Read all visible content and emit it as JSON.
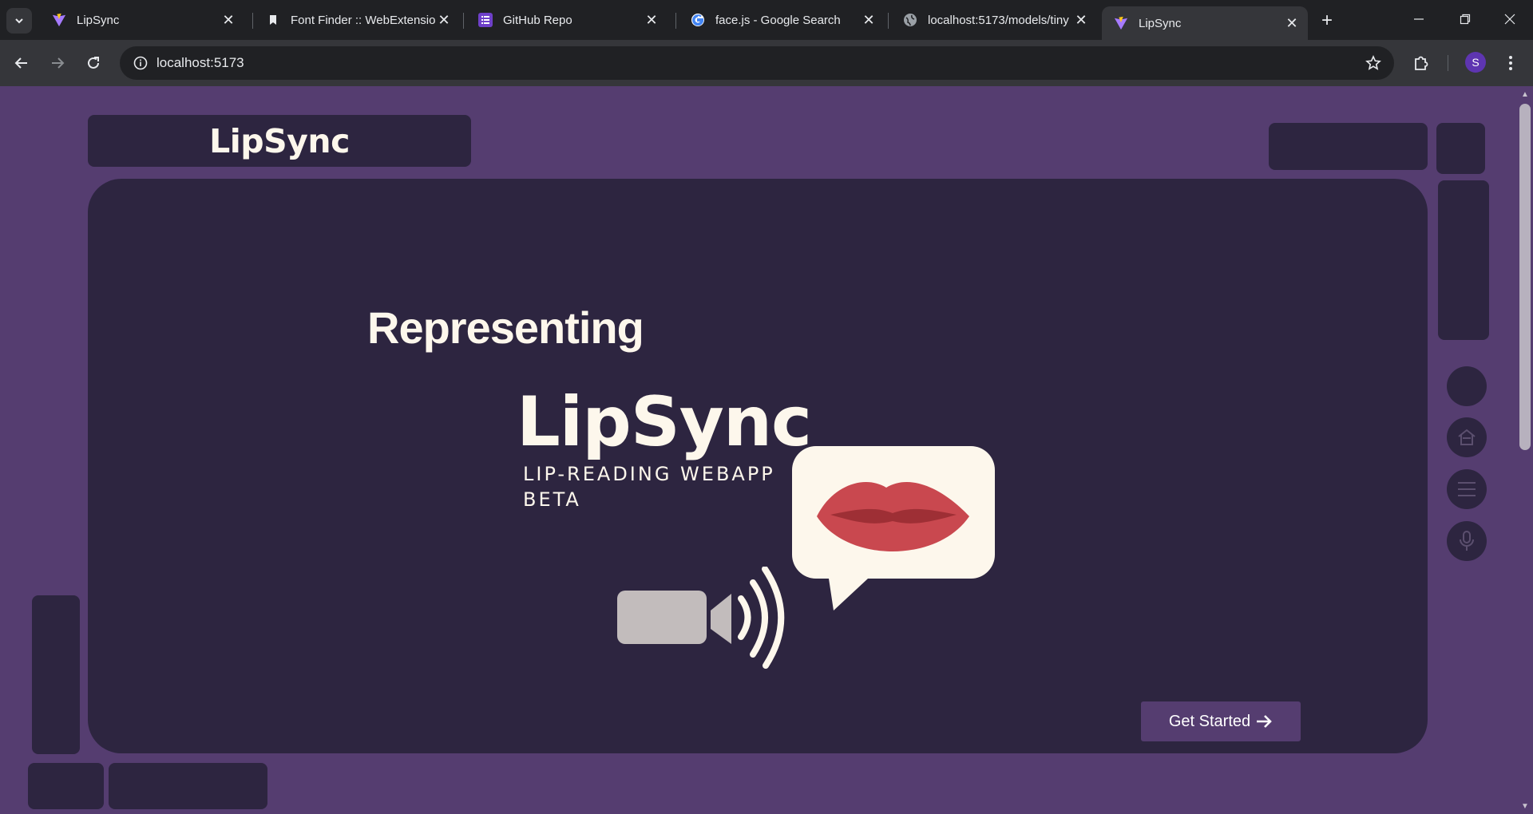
{
  "browser": {
    "tabs": [
      {
        "title": "LipSync",
        "favicon": "vite-icon",
        "active": false
      },
      {
        "title": "Font Finder :: WebExtension",
        "favicon": "bookmark-icon",
        "active": false
      },
      {
        "title": "GitHub Repo",
        "favicon": "list-icon",
        "active": false
      },
      {
        "title": "face.js - Google Search",
        "favicon": "google-icon",
        "active": false
      },
      {
        "title": "localhost:5173/models/tiny",
        "favicon": "globe-icon",
        "active": false
      },
      {
        "title": "LipSync",
        "favicon": "vite-icon",
        "active": true
      }
    ],
    "url": "localhost:5173",
    "profile_initial": "S",
    "colors": {
      "profile": "#5e35b1"
    }
  },
  "page": {
    "logo_text": "LipSync",
    "hero": {
      "heading": "Representing",
      "brand_title": "LipSync",
      "brand_subtitle_line1": "LIP-READING WEBAPP",
      "brand_subtitle_line2": "BETA",
      "cta_label": "Get Started"
    },
    "side_icons": [
      "home-icon",
      "menu-icon",
      "microphone-icon"
    ],
    "colors": {
      "page_bg": "#553d70",
      "panel_bg": "#2d2540",
      "text_cream": "#fdf7ec",
      "lips": "#c9484f",
      "camera": "#c2bcbc"
    }
  }
}
